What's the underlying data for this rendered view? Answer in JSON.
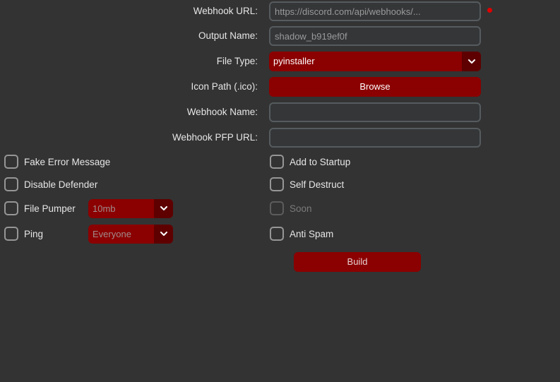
{
  "form": {
    "webhook_url": {
      "label": "Webhook URL:",
      "placeholder": "https://discord.com/api/webhooks/..."
    },
    "output_name": {
      "label": "Output Name:",
      "placeholder": "shadow_b919ef0f"
    },
    "file_type": {
      "label": "File Type:",
      "value": "pyinstaller"
    },
    "icon_path": {
      "label": "Icon Path (.ico):",
      "button_label": "Browse"
    },
    "webhook_name": {
      "label": "Webhook Name:",
      "placeholder": ""
    },
    "webhook_pfp_url": {
      "label": "Webhook PFP URL:",
      "placeholder": ""
    }
  },
  "options_left": {
    "fake_error": {
      "label": "Fake Error Message",
      "checked": false
    },
    "disable_defender": {
      "label": "Disable Defender",
      "checked": false
    },
    "file_pumper": {
      "label": "File Pumper",
      "checked": false,
      "select_value": "10mb"
    },
    "ping": {
      "label": "Ping",
      "checked": false,
      "select_value": "Everyone"
    }
  },
  "options_right": {
    "add_to_startup": {
      "label": "Add to Startup",
      "checked": false
    },
    "self_destruct": {
      "label": "Self Destruct",
      "checked": false
    },
    "soon": {
      "label": "Soon",
      "checked": false,
      "disabled": true
    },
    "anti_spam": {
      "label": "Anti Spam",
      "checked": false
    }
  },
  "actions": {
    "build_label": "Build"
  },
  "colors": {
    "background": "#333333",
    "accent": "#8b0000",
    "accent_dark": "#5e0000",
    "input_bg": "#343638",
    "input_border": "#565b5e",
    "status_dot": "#e00000"
  },
  "icons": {
    "dropdown": "chevron-down-icon",
    "status": "red-dot-icon"
  }
}
